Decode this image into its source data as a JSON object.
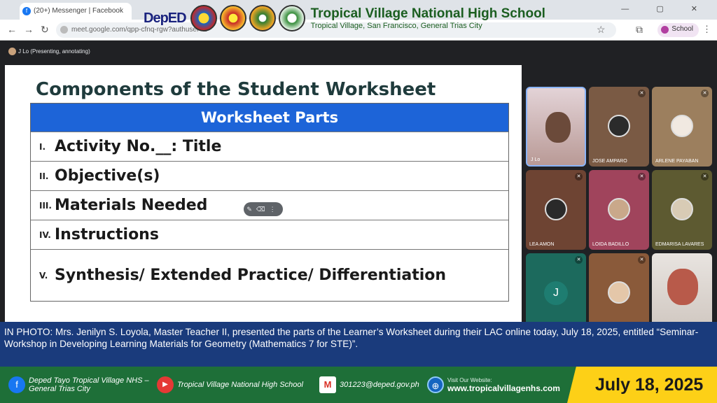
{
  "browser": {
    "tab_title": "(20+) Messenger | Facebook",
    "window_controls": "— ▢ ✕",
    "url": "meet.google.com/qpp-cfnq-rgw?authuser=1",
    "profile_label": "School"
  },
  "header": {
    "logo_text": "DepED",
    "school_name": "Tropical Village National High School",
    "school_address": "Tropical Village, San Francisco, General Trias City"
  },
  "meet": {
    "presenter_label": "J Lo (Presenting, annotating)",
    "slide": {
      "title": "Components of the Student Worksheet",
      "table_header": "Worksheet Parts",
      "rows": [
        {
          "num": "I.",
          "text": "Activity No.__: Title"
        },
        {
          "num": "II.",
          "text": "Objective(s)"
        },
        {
          "num": "III.",
          "text": "Materials Needed"
        },
        {
          "num": "IV.",
          "text": "Instructions"
        },
        {
          "num": "V.",
          "text": "Synthesis/ Extended Practice/ Differentiation"
        }
      ]
    },
    "participants": [
      {
        "name": "J Lo"
      },
      {
        "name": "JOSE AMPARO"
      },
      {
        "name": "ARLENE PAYABAN"
      },
      {
        "name": "LEA AMON"
      },
      {
        "name": "LOIDA BADILLO"
      },
      {
        "name": "EDMARISA LAVARES"
      },
      {
        "name": "",
        "initial": "J"
      },
      {
        "name": ""
      },
      {
        "name": ""
      }
    ]
  },
  "caption": "IN PHOTO: Mrs. Jenilyn S. Loyola, Master Teacher II, presented the parts of the Learner’s Worksheet during their LAC online today, July 18, 2025, entitled “Seminar-Workshop in Developing Learning Materials for Geometry (Mathematics 7 for STE)”.",
  "footer": {
    "facebook": "Deped Tayo Tropical Village NHS – General Trias City",
    "youtube": "Tropical Village National High School",
    "email": "301223@deped.gov.ph",
    "website_label": "Visit Our Website:",
    "website": "www.tropicalvillagenhs.com",
    "date": "July 18, 2025"
  },
  "colors": {
    "table_header": "#1d64d8",
    "footer_green": "#1e6f38",
    "caption_blue": "#1a3b7c",
    "date_yellow": "#fdd017"
  }
}
